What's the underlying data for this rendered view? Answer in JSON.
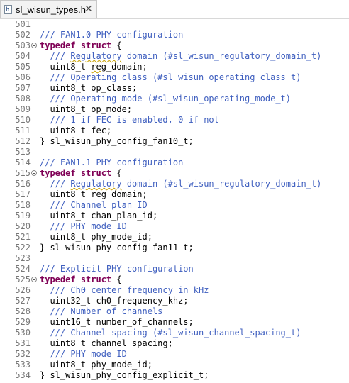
{
  "tab": {
    "title": "sl_wisun_types.h",
    "close_glyph": "✕",
    "icon_label": "h"
  },
  "lines": [
    {
      "n": "501",
      "fold": false,
      "parts": []
    },
    {
      "n": "502",
      "fold": false,
      "parts": [
        {
          "t": "/// FAN1.0 PHY configuration",
          "c": "cm"
        }
      ]
    },
    {
      "n": "503",
      "fold": true,
      "parts": [
        {
          "t": "typedef",
          "c": "kw"
        },
        {
          "t": " "
        },
        {
          "t": "struct",
          "c": "kw"
        },
        {
          "t": " {"
        }
      ]
    },
    {
      "n": "504",
      "fold": false,
      "parts": [
        {
          "t": "  "
        },
        {
          "t": "/// ",
          "c": "cm"
        },
        {
          "t": "Regulatory",
          "c": "cm sq"
        },
        {
          "t": " domain (#sl_wisun_regulatory_domain_t)",
          "c": "cm"
        }
      ]
    },
    {
      "n": "505",
      "fold": false,
      "parts": [
        {
          "t": "  uint8_t "
        },
        {
          "t": "reg",
          "c": "sq"
        },
        {
          "t": "_domain;"
        }
      ]
    },
    {
      "n": "506",
      "fold": false,
      "parts": [
        {
          "t": "  "
        },
        {
          "t": "/// Operating class (#sl_wisun_operating_class_t)",
          "c": "cm"
        }
      ]
    },
    {
      "n": "507",
      "fold": false,
      "parts": [
        {
          "t": "  uint8_t op_class;"
        }
      ]
    },
    {
      "n": "508",
      "fold": false,
      "parts": [
        {
          "t": "  "
        },
        {
          "t": "/// Operating mode (#sl_wisun_operating_mode_t)",
          "c": "cm"
        }
      ]
    },
    {
      "n": "509",
      "fold": false,
      "parts": [
        {
          "t": "  uint8_t op_mode;"
        }
      ]
    },
    {
      "n": "510",
      "fold": false,
      "parts": [
        {
          "t": "  "
        },
        {
          "t": "/// 1 if FEC is enabled, 0 if not",
          "c": "cm"
        }
      ]
    },
    {
      "n": "511",
      "fold": false,
      "parts": [
        {
          "t": "  uint8_t fec;"
        }
      ]
    },
    {
      "n": "512",
      "fold": false,
      "parts": [
        {
          "t": "} sl_wisun_phy_config_fan10_t;"
        }
      ]
    },
    {
      "n": "513",
      "fold": false,
      "parts": []
    },
    {
      "n": "514",
      "fold": false,
      "parts": [
        {
          "t": "/// FAN1.1 PHY configuration",
          "c": "cm"
        }
      ]
    },
    {
      "n": "515",
      "fold": true,
      "parts": [
        {
          "t": "typedef",
          "c": "kw"
        },
        {
          "t": " "
        },
        {
          "t": "struct",
          "c": "kw"
        },
        {
          "t": " {"
        }
      ]
    },
    {
      "n": "516",
      "fold": false,
      "parts": [
        {
          "t": "  "
        },
        {
          "t": "/// ",
          "c": "cm"
        },
        {
          "t": "Regulatory",
          "c": "cm sq"
        },
        {
          "t": " domain (#sl_wisun_regulatory_domain_t)",
          "c": "cm"
        }
      ]
    },
    {
      "n": "517",
      "fold": false,
      "parts": [
        {
          "t": "  uint8_t reg_domain;"
        }
      ]
    },
    {
      "n": "518",
      "fold": false,
      "parts": [
        {
          "t": "  "
        },
        {
          "t": "/// Channel plan ID",
          "c": "cm"
        }
      ]
    },
    {
      "n": "519",
      "fold": false,
      "parts": [
        {
          "t": "  uint8_t chan_plan_id;"
        }
      ]
    },
    {
      "n": "520",
      "fold": false,
      "parts": [
        {
          "t": "  "
        },
        {
          "t": "/// PHY mode ID",
          "c": "cm"
        }
      ]
    },
    {
      "n": "521",
      "fold": false,
      "parts": [
        {
          "t": "  uint8_t phy_mode_id;"
        }
      ]
    },
    {
      "n": "522",
      "fold": false,
      "parts": [
        {
          "t": "} sl_wisun_phy_config_fan11_t;"
        }
      ]
    },
    {
      "n": "523",
      "fold": false,
      "parts": []
    },
    {
      "n": "524",
      "fold": false,
      "parts": [
        {
          "t": "/// Explicit PHY configuration",
          "c": "cm"
        }
      ]
    },
    {
      "n": "525",
      "fold": true,
      "parts": [
        {
          "t": "typedef",
          "c": "kw"
        },
        {
          "t": " "
        },
        {
          "t": "struct",
          "c": "kw"
        },
        {
          "t": " {"
        }
      ]
    },
    {
      "n": "526",
      "fold": false,
      "parts": [
        {
          "t": "  "
        },
        {
          "t": "/// Ch0 center frequency in kHz",
          "c": "cm"
        }
      ]
    },
    {
      "n": "527",
      "fold": false,
      "parts": [
        {
          "t": "  uint32_t ch0_frequency_khz;"
        }
      ]
    },
    {
      "n": "528",
      "fold": false,
      "parts": [
        {
          "t": "  "
        },
        {
          "t": "/// Number of channels",
          "c": "cm"
        }
      ]
    },
    {
      "n": "529",
      "fold": false,
      "parts": [
        {
          "t": "  uint16_t number_of_channels;"
        }
      ]
    },
    {
      "n": "530",
      "fold": false,
      "parts": [
        {
          "t": "  "
        },
        {
          "t": "/// Channel spacing (#sl_wisun_channel_spacing_t)",
          "c": "cm"
        }
      ]
    },
    {
      "n": "531",
      "fold": false,
      "parts": [
        {
          "t": "  uint8_t channel_spacing;"
        }
      ]
    },
    {
      "n": "532",
      "fold": false,
      "parts": [
        {
          "t": "  "
        },
        {
          "t": "/// PHY mode ID",
          "c": "cm"
        }
      ]
    },
    {
      "n": "533",
      "fold": false,
      "parts": [
        {
          "t": "  uint8_t phy_mode_id;"
        }
      ]
    },
    {
      "n": "534",
      "fold": false,
      "parts": [
        {
          "t": "} sl_wisun_phy_config_explicit_t;"
        }
      ]
    }
  ],
  "colors": {
    "comment": "#3f5fbf",
    "keyword": "#7f0055",
    "line_number": "#787878"
  }
}
